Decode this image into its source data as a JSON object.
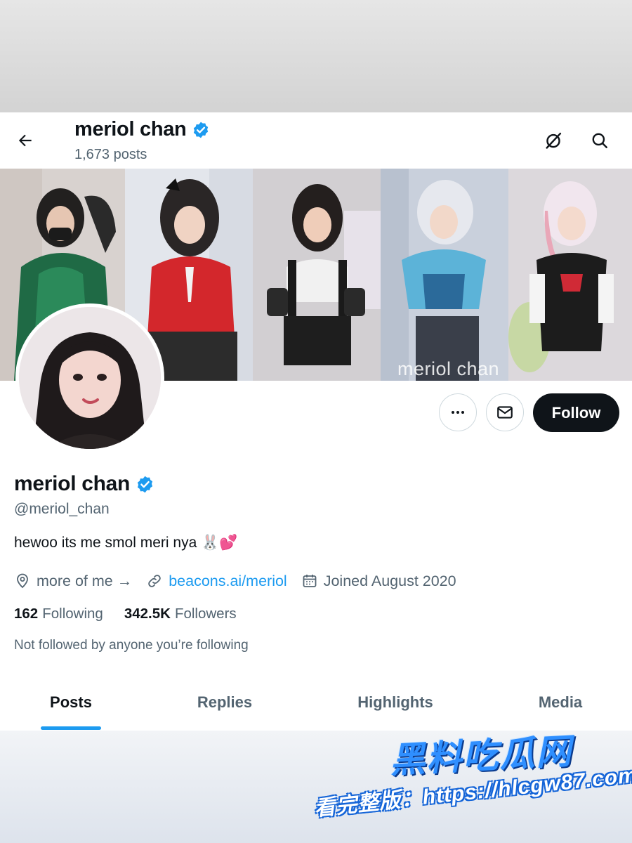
{
  "header": {
    "name": "meriol chan",
    "posts_count": "1,673 posts"
  },
  "banner": {
    "watermark": "meriol chan"
  },
  "actions": {
    "follow_label": "Follow"
  },
  "profile": {
    "display_name": "meriol chan",
    "handle": "@meriol_chan",
    "bio": "hewoo its me smol meri nya",
    "bio_emoji": "🐰💕",
    "location": "more of me →",
    "website": "beacons.ai/meriol",
    "joined": "Joined August 2020"
  },
  "stats": {
    "following_count": "162",
    "following_label": "Following",
    "followers_count": "342.5K",
    "followers_label": "Followers"
  },
  "not_followed_text": "Not followed by anyone you’re following",
  "tabs": [
    {
      "label": "Posts"
    },
    {
      "label": "Replies"
    },
    {
      "label": "Highlights"
    },
    {
      "label": "Media"
    }
  ],
  "active_tab": "Posts",
  "overlay": {
    "brand": "黑料吃瓜网",
    "promo": "看完整版：https://hlcgw87.com"
  },
  "colors": {
    "accent": "#1d9bf0",
    "text_primary": "#0f1419",
    "text_secondary": "#536471",
    "follow_button_bg": "#0f1419"
  },
  "icons": {
    "back": "arrow-left-icon",
    "verified": "verified-badge-icon",
    "grok": "grok-icon",
    "search": "search-icon",
    "more": "more-horizontal-icon",
    "message": "envelope-icon",
    "location": "location-pin-icon",
    "link": "link-icon",
    "calendar": "calendar-icon"
  }
}
